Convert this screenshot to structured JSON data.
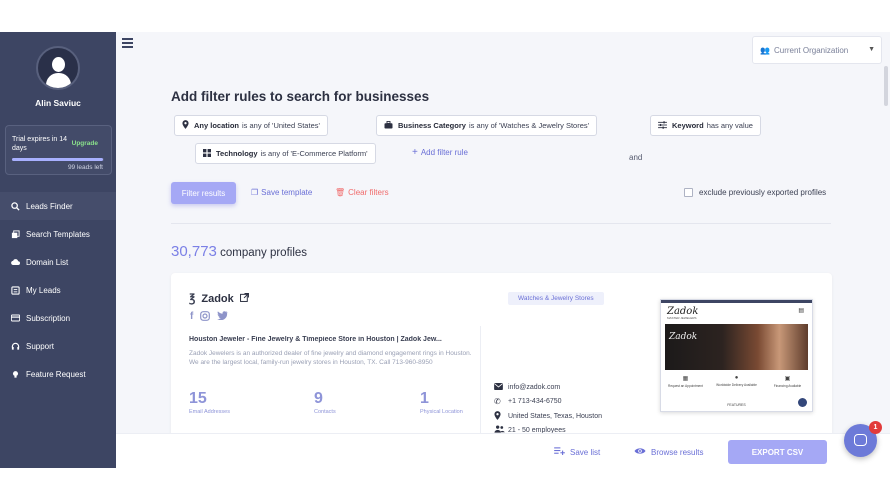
{
  "user": {
    "name": "Alin Saviuc"
  },
  "trial": {
    "text": "Trial expires in 14 days",
    "upgrade": "Upgrade",
    "leads_left": "99 leads left",
    "progress": 0.99
  },
  "nav": [
    {
      "label": "Leads Finder",
      "icon": "search-icon"
    },
    {
      "label": "Search Templates",
      "icon": "templates-icon"
    },
    {
      "label": "Domain List",
      "icon": "cloud-icon"
    },
    {
      "label": "My Leads",
      "icon": "list-icon"
    },
    {
      "label": "Subscription",
      "icon": "card-icon"
    },
    {
      "label": "Support",
      "icon": "headset-icon"
    },
    {
      "label": "Feature Request",
      "icon": "bulb-icon"
    }
  ],
  "org": {
    "label": "Current Organization"
  },
  "title": "Add filter rules to search for businesses",
  "filters": {
    "location": {
      "name": "Any location",
      "rest": "is any of 'United States'"
    },
    "category": {
      "name": "Business Category",
      "rest": "is any of 'Watches & Jewelry Stores'"
    },
    "keyword": {
      "name": "Keyword",
      "rest": "has any value"
    },
    "technology": {
      "name": "Technology",
      "rest": "is any of 'E-Commerce Platform'"
    },
    "and": "and",
    "add_rule": "Add filter rule"
  },
  "actions": {
    "filter": "Filter results",
    "save_template": "Save template",
    "clear": "Clear filters",
    "exclude": "exclude previously exported profiles"
  },
  "results": {
    "count": "30,773",
    "label": "company profiles"
  },
  "company": {
    "name": "Zadok",
    "headline": "Houston Jeweler - Fine Jewelry & Timepiece Store in Houston | Zadok Jew...",
    "description": "Zadok Jewelers is an authorized dealer of fine jewelry and diamond engagement rings in Houston. We are the largest local, family-run jewelry stores in Houston, TX. Call 713-960-8950",
    "stats": [
      {
        "value": "15",
        "label": "Email Addresses"
      },
      {
        "value": "9",
        "label": "Contacts"
      },
      {
        "value": "1",
        "label": "Physical Location"
      }
    ],
    "category": "Watches & Jewelry Stores",
    "email": "info@zadok.com",
    "phone": "+1 713-434-6750",
    "location": "United States, Texas, Houston",
    "employees": "21 - 50 employees",
    "thumb": {
      "logo": "Zadok",
      "tagline": "MASTER JEWELERS",
      "feat1": "Request an Appointment",
      "feat2": "Worldwide Delivery Available",
      "feat3": "Financing Available",
      "footer": "FEATURES"
    }
  },
  "bottom": {
    "save_list": "Save list",
    "browse": "Browse results",
    "export": "EXPORT CSV"
  },
  "chat": {
    "badge": "1"
  }
}
